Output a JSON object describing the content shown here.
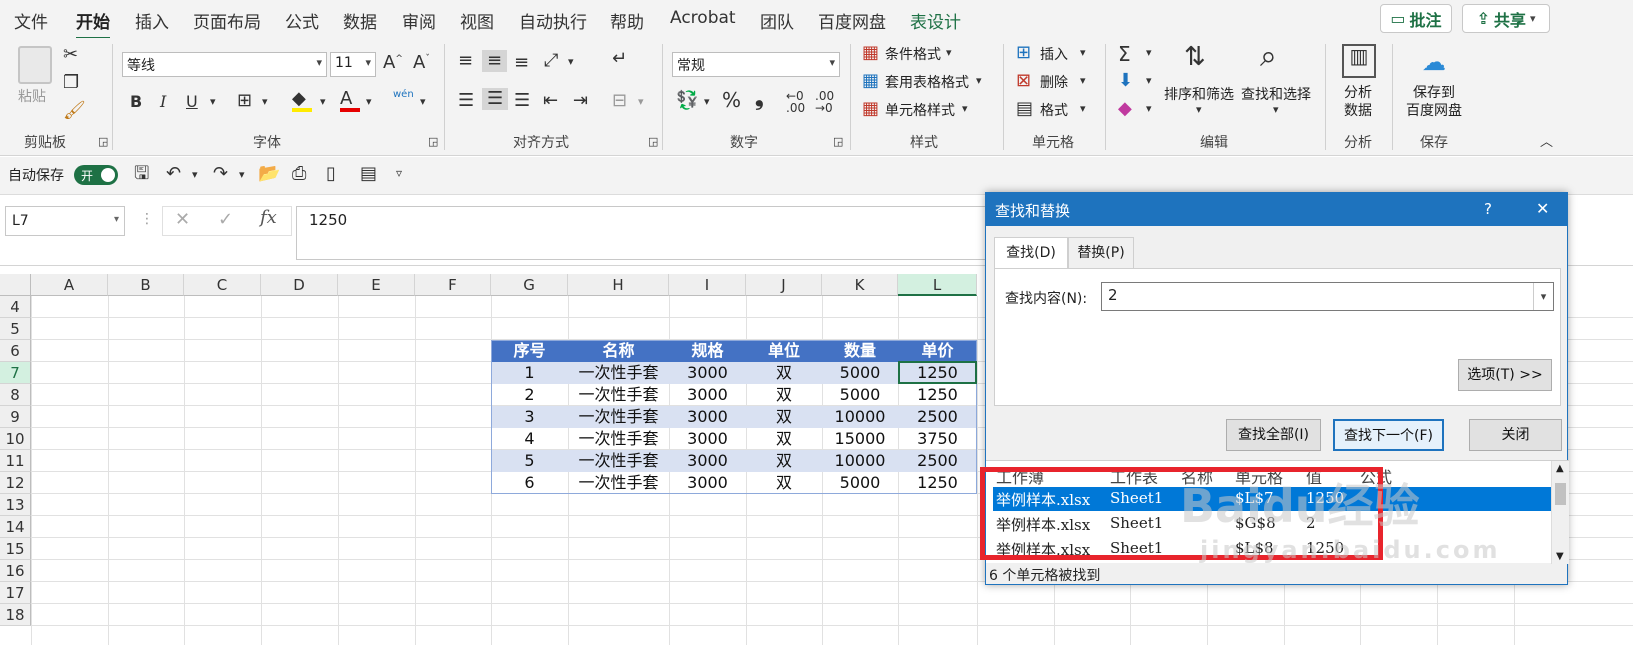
{
  "menu": {
    "items": [
      "文件",
      "开始",
      "插入",
      "页面布局",
      "公式",
      "数据",
      "审阅",
      "视图",
      "自动执行",
      "帮助",
      "Acrobat",
      "团队",
      "百度网盘",
      "表设计"
    ],
    "active": "开始",
    "comment_btn": "批注",
    "share_btn": "共享"
  },
  "ribbon": {
    "clipboard": {
      "paste": "粘贴",
      "label": "剪贴板"
    },
    "font": {
      "name": "等线",
      "size": "11",
      "label": "字体",
      "bold": "B",
      "italic": "I",
      "underline": "U",
      "phonetic": "wén"
    },
    "alignment": {
      "label": "对齐方式"
    },
    "number": {
      "format": "常规",
      "label": "数字"
    },
    "styles": {
      "conditional": "条件格式",
      "table_format": "套用表格格式",
      "cell_styles": "单元格样式",
      "label": "样式"
    },
    "cells": {
      "insert": "插入",
      "delete": "删除",
      "format": "格式",
      "label": "单元格"
    },
    "editing": {
      "sort_filter": "排序和筛选",
      "find_select": "查找和选择",
      "label": "编辑"
    },
    "analysis": {
      "analyze": "分析\n数据",
      "label": "分析"
    },
    "save": {
      "save_baidu": "保存到\n百度网盘",
      "label": "保存"
    }
  },
  "qat": {
    "autosave_label": "自动保存",
    "toggle": "开"
  },
  "formula_bar": {
    "name_box": "L7",
    "fx": "fx",
    "value": "1250"
  },
  "grid": {
    "columns": [
      "A",
      "B",
      "C",
      "D",
      "E",
      "F",
      "G",
      "H",
      "I",
      "J",
      "K",
      "L"
    ],
    "rows": [
      "4",
      "5",
      "6",
      "7",
      "8",
      "9",
      "10",
      "11",
      "12",
      "13",
      "14",
      "15",
      "16",
      "17",
      "18"
    ],
    "table_headers": [
      "序号",
      "名称",
      "规格",
      "单位",
      "数量",
      "单价"
    ],
    "table_rows": [
      [
        "1",
        "一次性手套",
        "3000",
        "双",
        "5000",
        "1250"
      ],
      [
        "2",
        "一次性手套",
        "3000",
        "双",
        "5000",
        "1250"
      ],
      [
        "3",
        "一次性手套",
        "3000",
        "双",
        "10000",
        "2500"
      ],
      [
        "4",
        "一次性手套",
        "3000",
        "双",
        "15000",
        "3750"
      ],
      [
        "5",
        "一次性手套",
        "3000",
        "双",
        "10000",
        "2500"
      ],
      [
        "6",
        "一次性手套",
        "3000",
        "双",
        "5000",
        "1250"
      ]
    ]
  },
  "dialog": {
    "title": "查找和替换",
    "help": "?",
    "close_x": "✕",
    "tabs": [
      "查找(D)",
      "替换(P)"
    ],
    "find_label": "查找内容(N):",
    "find_value": "2",
    "options_btn": "选项(T) >>",
    "find_all_btn": "查找全部(I)",
    "find_next_btn": "查找下一个(F)",
    "close_btn": "关闭",
    "result_headers": [
      "工作薄",
      "工作表",
      "名称",
      "单元格",
      "值",
      "公式"
    ],
    "results": [
      [
        "举例样本.xlsx",
        "Sheet1",
        "",
        "$L$7",
        "1250",
        ""
      ],
      [
        "举例样本.xlsx",
        "Sheet1",
        "",
        "$G$8",
        "2",
        ""
      ],
      [
        "举例样本.xlsx",
        "Sheet1",
        "",
        "$L$8",
        "1250",
        ""
      ]
    ],
    "status": "6 个单元格被找到"
  },
  "watermark": {
    "brand": "Baidu经验",
    "url": "jingyan.baidu.com"
  },
  "colors": {
    "accent": "#1e7145",
    "table_header": "#4472c4",
    "band": "#d9e1f2",
    "dialog_title": "#1e73be",
    "highlight_box": "#e8242c"
  }
}
